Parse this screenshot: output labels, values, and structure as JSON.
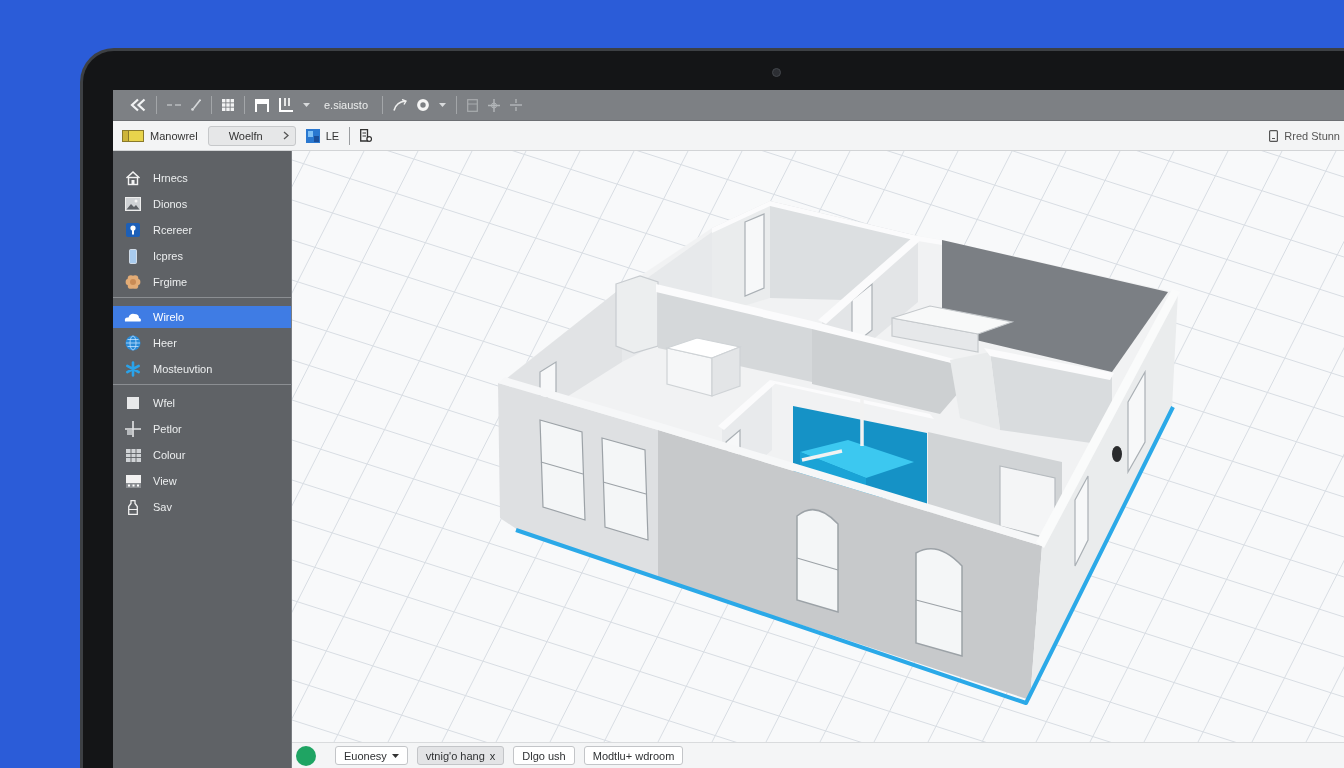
{
  "toolbar": {
    "label": "e.siausto"
  },
  "ribbon": {
    "items": [
      {
        "kind": "menu",
        "label": "Manowrel"
      },
      {
        "kind": "dropdown",
        "label": "Woelfn"
      },
      {
        "kind": "menu",
        "label": "LE"
      }
    ],
    "user": "Rred Stunn"
  },
  "sidebar": {
    "sections": [
      {
        "items": [
          {
            "label": "Hrnecs",
            "selected": false
          },
          {
            "label": "Dionos",
            "selected": false
          },
          {
            "label": "Rcereer",
            "selected": false
          },
          {
            "label": "Icpres",
            "selected": false
          },
          {
            "label": "Frgime",
            "selected": false
          }
        ]
      },
      {
        "items": [
          {
            "label": "Wirelo",
            "selected": true
          },
          {
            "label": "Heer",
            "selected": false
          },
          {
            "label": "Mosteuvtion",
            "selected": false
          }
        ]
      },
      {
        "items": [
          {
            "label": "Wfel",
            "selected": false
          },
          {
            "label": "Petlor",
            "selected": false
          },
          {
            "label": "Colour",
            "selected": false
          },
          {
            "label": "View",
            "selected": false
          },
          {
            "label": "Sav",
            "selected": false
          }
        ]
      }
    ]
  },
  "bottom_bar": {
    "chips": [
      {
        "kind": "dropdown",
        "label": "Euonesy"
      },
      {
        "kind": "tag",
        "label": "vtnig'o hang",
        "close": "x"
      },
      {
        "kind": "button",
        "label": "Dlgo ush"
      },
      {
        "kind": "button",
        "label": "Modtlu+ wdroom"
      }
    ]
  }
}
